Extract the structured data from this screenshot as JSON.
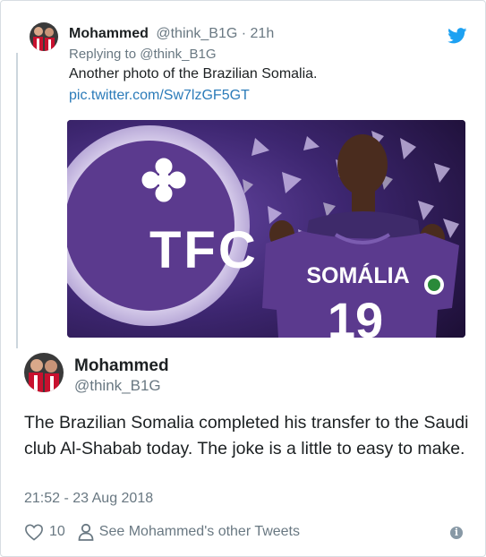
{
  "reply": {
    "name": "Mohammed",
    "handle": "@think_B1G",
    "separator": " · ",
    "time": "21h",
    "replying_to": "Replying to @think_B1G",
    "text": "Another photo of the Brazilian Somalia.",
    "link": "pic.twitter.com/Sw7lzGF5GT"
  },
  "photo": {
    "wall_letters": "TFC",
    "jersey_name": "SOMÁLIA",
    "jersey_number": "19"
  },
  "tweet": {
    "name": "Mohammed",
    "handle": "@think_B1G",
    "text": "The Brazilian Somalia completed his transfer to the Saudi club Al-Shabab today. The joke is a little to easy to make.",
    "date": "21:52 - 23 Aug 2018",
    "likes": "10",
    "other_tweets_label": "See Mohammed's other Tweets",
    "info_glyph": "i"
  },
  "colors": {
    "link": "#2b7bb9",
    "muted": "#697882",
    "twitter_blue": "#1da1f2",
    "club_purple": "#5b3a8e"
  }
}
